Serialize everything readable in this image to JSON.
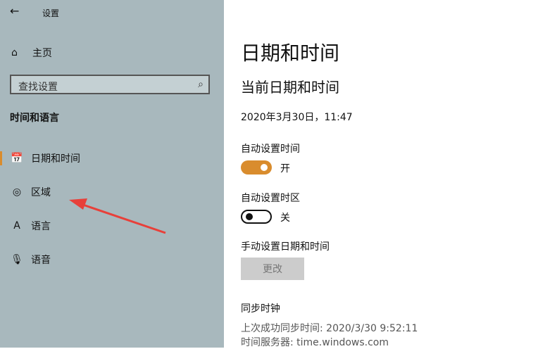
{
  "window": {
    "back_icon": "back-arrow-icon",
    "title": "设置"
  },
  "sidebar": {
    "home": {
      "icon": "home-icon",
      "label": "主页"
    },
    "search": {
      "placeholder": "查找设置",
      "icon": "search-icon"
    },
    "section_title": "时间和语言",
    "items": [
      {
        "icon": "calendar-clock-icon",
        "label": "日期和时间",
        "selected": true
      },
      {
        "icon": "globe-region-icon",
        "label": "区域"
      },
      {
        "icon": "language-icon",
        "label": "语言"
      },
      {
        "icon": "microphone-icon",
        "label": "语音"
      }
    ]
  },
  "main": {
    "title": "日期和时间",
    "subtitle": "当前日期和时间",
    "current_datetime": "2020年3月30日，11:47",
    "auto_time": {
      "label": "自动设置时间",
      "state": "开",
      "on": true
    },
    "auto_timezone": {
      "label": "自动设置时区",
      "state": "关",
      "on": false
    },
    "manual": {
      "label": "手动设置日期和时间",
      "button": "更改"
    },
    "sync": {
      "title": "同步时钟",
      "last_sync": "上次成功同步时间: 2020/3/30 9:52:11",
      "server": "时间服务器: time.windows.com"
    }
  },
  "colors": {
    "accent": "#d98c2d",
    "sidebar_bg": "#a8b8bd"
  }
}
